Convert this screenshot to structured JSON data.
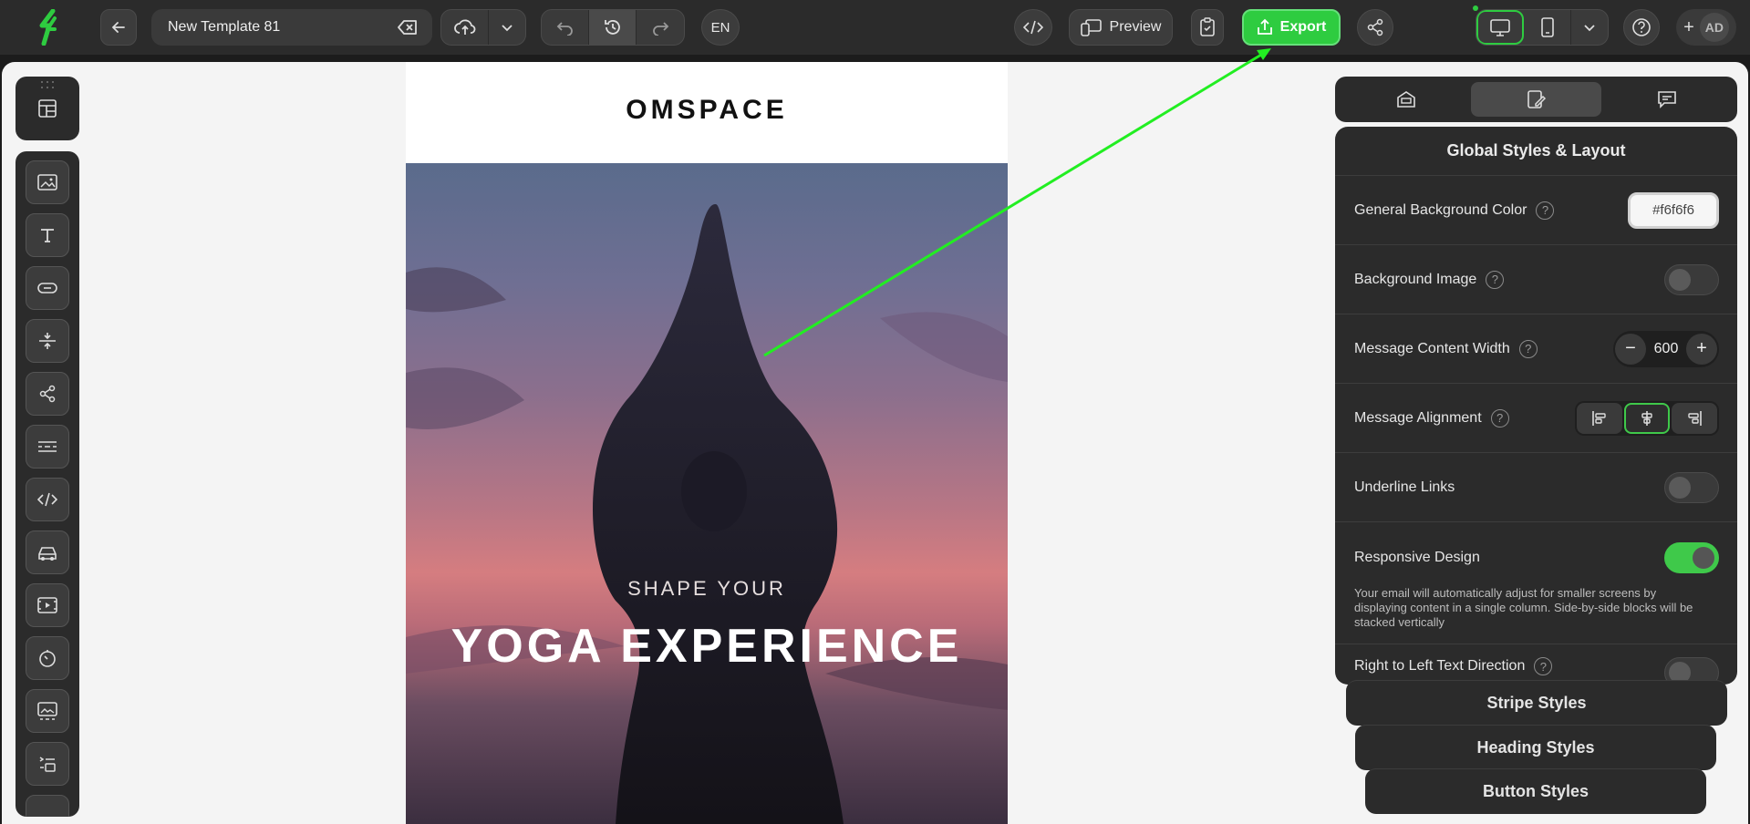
{
  "header": {
    "template_name": "New Template 81",
    "language": "EN",
    "preview_label": "Preview",
    "export_label": "Export",
    "avatar_initials": "AD"
  },
  "email": {
    "brand": "OMSPACE",
    "hero_subtitle": "SHAPE YOUR",
    "hero_title": "YOGA EXPERIENCE"
  },
  "panel": {
    "title": "Global Styles & Layout",
    "rows": {
      "bg_color_label": "General Background Color",
      "bg_color_value": "#f6f6f6",
      "bg_image_label": "Background Image",
      "width_label": "Message Content Width",
      "width_value": "600",
      "alignment_label": "Message Alignment",
      "underline_label": "Underline Links",
      "responsive_label": "Responsive Design",
      "responsive_desc": "Your email will automatically adjust for smaller screens by displaying content in a single column. Side-by-side blocks will be stacked vertically",
      "rtl_label": "Right to Left Text Direction"
    },
    "toggles": {
      "background_image": false,
      "underline_links": false,
      "responsive_design": true,
      "rtl": false
    },
    "stack": {
      "stripe": "Stripe Styles",
      "heading": "Heading Styles",
      "button": "Button Styles"
    }
  },
  "colors": {
    "accent": "#2ecc40",
    "annotation_arrow": "#22ee22"
  }
}
